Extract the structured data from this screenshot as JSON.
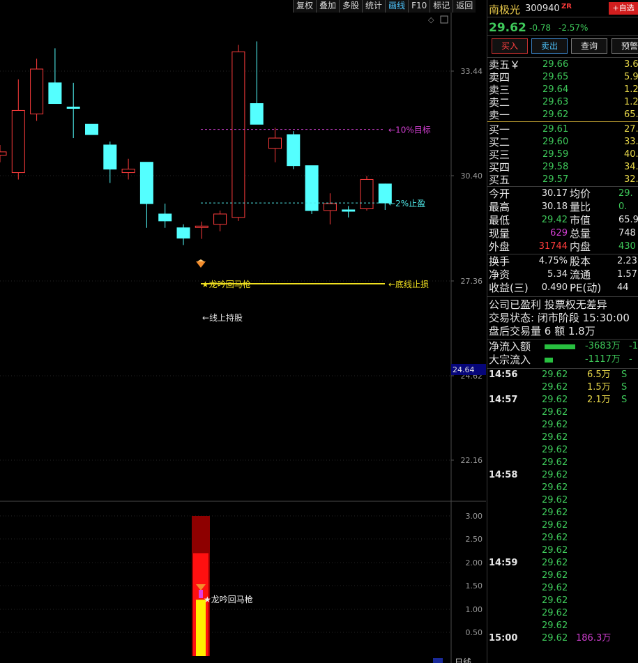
{
  "toolbar": {
    "items": [
      "复权",
      "叠加",
      "多股",
      "统计",
      "画线",
      "F10",
      "标记",
      "返回"
    ],
    "active_index": 4
  },
  "chart_data": {
    "type": "candlestick",
    "y_ticks": [
      "33.44",
      "30.40",
      "27.36",
      "24.62",
      "22.16"
    ],
    "price_marker": "24.64",
    "candles": [
      {
        "o": 31.0,
        "h": 31.3,
        "l": 30.8,
        "c": 31.1,
        "dir": "up"
      },
      {
        "o": 30.5,
        "h": 33.2,
        "l": 30.3,
        "c": 32.3,
        "dir": "up"
      },
      {
        "o": 32.2,
        "h": 33.8,
        "l": 32.0,
        "c": 33.5,
        "dir": "up"
      },
      {
        "o": 33.1,
        "h": 34.1,
        "l": 32.6,
        "c": 32.5,
        "dir": "down"
      },
      {
        "o": 32.4,
        "h": 33.1,
        "l": 31.5,
        "c": 32.4,
        "dir": "down"
      },
      {
        "o": 31.9,
        "h": 31.9,
        "l": 31.6,
        "c": 31.6,
        "dir": "down"
      },
      {
        "o": 31.3,
        "h": 31.4,
        "l": 30.2,
        "c": 30.6,
        "dir": "down"
      },
      {
        "o": 30.5,
        "h": 30.9,
        "l": 30.3,
        "c": 30.6,
        "dir": "up"
      },
      {
        "o": 30.8,
        "h": 30.8,
        "l": 28.9,
        "c": 29.6,
        "dir": "down"
      },
      {
        "o": 29.3,
        "h": 29.6,
        "l": 28.9,
        "c": 29.1,
        "dir": "down"
      },
      {
        "o": 28.9,
        "h": 29.0,
        "l": 28.4,
        "c": 28.6,
        "dir": "down"
      },
      {
        "o": 28.92,
        "h": 29.08,
        "l": 28.58,
        "c": 28.95,
        "dir": "up"
      },
      {
        "o": 29.0,
        "h": 29.4,
        "l": 28.8,
        "c": 29.3,
        "dir": "up"
      },
      {
        "o": 29.2,
        "h": 34.2,
        "l": 29.1,
        "c": 34.0,
        "dir": "up"
      },
      {
        "o": 32.5,
        "h": 34.3,
        "l": 32.3,
        "c": 31.9,
        "dir": "down"
      },
      {
        "o": 31.2,
        "h": 31.8,
        "l": 30.8,
        "c": 31.5,
        "dir": "up"
      },
      {
        "o": 31.6,
        "h": 31.7,
        "l": 30.6,
        "c": 30.7,
        "dir": "down"
      },
      {
        "o": 30.7,
        "h": 30.7,
        "l": 29.3,
        "c": 29.4,
        "dir": "down"
      },
      {
        "o": 29.4,
        "h": 29.9,
        "l": 29.0,
        "c": 29.6,
        "dir": "up"
      },
      {
        "o": 29.42,
        "h": 29.53,
        "l": 29.2,
        "c": 29.4,
        "dir": "down"
      },
      {
        "o": 29.45,
        "h": 30.4,
        "l": 29.4,
        "c": 30.3,
        "dir": "up"
      },
      {
        "o": 30.17,
        "h": 30.18,
        "l": 29.42,
        "c": 29.62,
        "dir": "down"
      }
    ],
    "lines": [
      {
        "label": "←10%目标",
        "value": 31.75,
        "style": "dashed",
        "color": "#d23fd2"
      },
      {
        "label": "←2%止盈",
        "value": 29.62,
        "style": "dashed",
        "color": "#4fe6e6"
      },
      {
        "label": "←底线止损",
        "value": 27.28,
        "style": "solid",
        "color": "#f0e020"
      }
    ],
    "annotations": [
      "★龙吟回马枪",
      "←线上持股"
    ],
    "sub_chart": {
      "y_ticks": [
        "3.00",
        "2.50",
        "2.00",
        "1.50",
        "1.00",
        "0.50"
      ],
      "bar_levels": {
        "dark_red": 3.0,
        "red": 2.2,
        "yellow": 1.2
      },
      "annotation": "★龙吟回马枪"
    }
  },
  "stock": {
    "name": "南极光",
    "code": "300940",
    "tag": "ZR",
    "add_label": "+自选",
    "price": "29.62",
    "change": "-0.78",
    "change_pct": "-2.57%"
  },
  "buttons": {
    "buy": "买入",
    "sell": "卖出",
    "quote": "查询",
    "alert": "预警"
  },
  "order_book": {
    "asks": [
      {
        "label": "卖五￥",
        "price": "29.66",
        "vol": "3.6"
      },
      {
        "label": "卖四",
        "price": "29.65",
        "vol": "5.9"
      },
      {
        "label": "卖三",
        "price": "29.64",
        "vol": "1.2"
      },
      {
        "label": "卖二",
        "price": "29.63",
        "vol": "1.2"
      },
      {
        "label": "卖一",
        "price": "29.62",
        "vol": "65.8"
      }
    ],
    "bids": [
      {
        "label": "买一",
        "price": "29.61",
        "vol": "27.5"
      },
      {
        "label": "买二",
        "price": "29.60",
        "vol": "33.4"
      },
      {
        "label": "买三",
        "price": "29.59",
        "vol": "40.5"
      },
      {
        "label": "买四",
        "price": "29.58",
        "vol": "34.6"
      },
      {
        "label": "买五",
        "price": "29.57",
        "vol": "32.2"
      }
    ]
  },
  "stats": [
    {
      "l1": "今开",
      "v1": "30.17",
      "l2": "均价",
      "v2": "29."
    },
    {
      "l1": "最高",
      "v1": "30.18",
      "l2": "量比",
      "v2": "0."
    },
    {
      "l1": "最低",
      "v1": "29.42",
      "l2": "市值",
      "v2": "65.9"
    },
    {
      "l1": "现量",
      "v1": "629",
      "l2": "总量",
      "v2": "748"
    },
    {
      "l1": "外盘",
      "v1": "31744",
      "l2": "内盘",
      "v2": "430"
    }
  ],
  "stats2": [
    {
      "l1": "换手",
      "v1": "4.75%",
      "l2": "股本",
      "v2": "2.23"
    },
    {
      "l1": "净资",
      "v1": "5.34",
      "l2": "流通",
      "v2": "1.57"
    },
    {
      "l1": "收益(三)",
      "v1": "0.490",
      "l2": "PE(动)",
      "v2": "44"
    }
  ],
  "info": {
    "profit": "公司已盈利 投票权无差异",
    "status": "交易状态: 闭市阶段 15:30:00",
    "after": "盘后交易量 6 额 1.8万"
  },
  "flows": [
    {
      "label": "净流入额",
      "value": "-3683万",
      "extra": "-1"
    },
    {
      "label": "大宗流入",
      "value": "-1117万",
      "extra": "-"
    }
  ],
  "ticks": [
    {
      "time": "14:56",
      "price": "29.62",
      "vol": "6.5万",
      "side": "S"
    },
    {
      "time": "",
      "price": "29.62",
      "vol": "1.5万",
      "side": "S"
    },
    {
      "time": "14:57",
      "price": "29.62",
      "vol": "2.1万",
      "side": "S"
    },
    {
      "time": "",
      "price": "29.62",
      "vol": "",
      "side": ""
    },
    {
      "time": "",
      "price": "29.62",
      "vol": "",
      "side": ""
    },
    {
      "time": "",
      "price": "29.62",
      "vol": "",
      "side": ""
    },
    {
      "time": "",
      "price": "29.62",
      "vol": "",
      "side": ""
    },
    {
      "time": "",
      "price": "29.62",
      "vol": "",
      "side": ""
    },
    {
      "time": "14:58",
      "price": "29.62",
      "vol": "",
      "side": ""
    },
    {
      "time": "",
      "price": "29.62",
      "vol": "",
      "side": ""
    },
    {
      "time": "",
      "price": "29.62",
      "vol": "",
      "side": ""
    },
    {
      "time": "",
      "price": "29.62",
      "vol": "",
      "side": ""
    },
    {
      "time": "",
      "price": "29.62",
      "vol": "",
      "side": ""
    },
    {
      "time": "",
      "price": "29.62",
      "vol": "",
      "side": ""
    },
    {
      "time": "",
      "price": "29.62",
      "vol": "",
      "side": ""
    },
    {
      "time": "14:59",
      "price": "29.62",
      "vol": "",
      "side": ""
    },
    {
      "time": "",
      "price": "29.62",
      "vol": "",
      "side": ""
    },
    {
      "time": "",
      "price": "29.62",
      "vol": "",
      "side": ""
    },
    {
      "time": "",
      "price": "29.62",
      "vol": "",
      "side": ""
    },
    {
      "time": "",
      "price": "29.62",
      "vol": "",
      "side": ""
    },
    {
      "time": "",
      "price": "29.62",
      "vol": "",
      "side": ""
    },
    {
      "time": "15:00",
      "price": "29.62",
      "vol": "186.3万",
      "side": ""
    }
  ],
  "bottom_label": "日线",
  "colors": {
    "up": "#ff3c3c",
    "down": "#54ffff",
    "green": "#3ec95a",
    "yellow": "#e8d84a",
    "magenta": "#d23fd2"
  }
}
